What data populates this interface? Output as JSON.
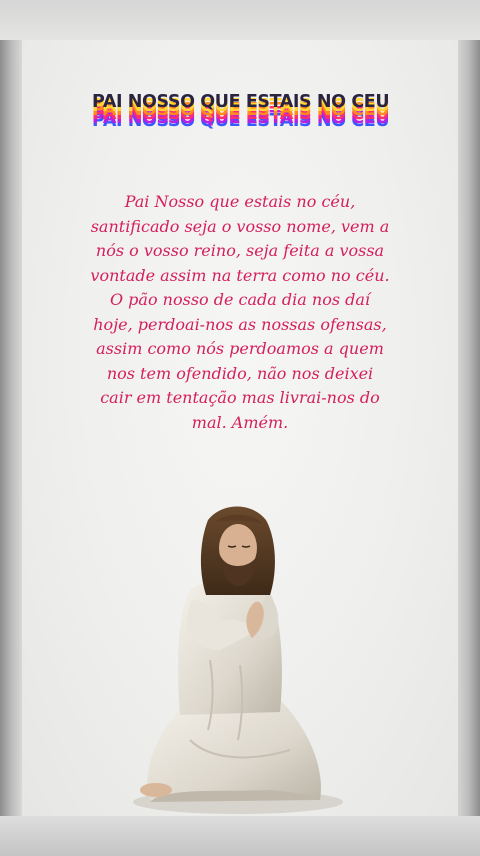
{
  "title": "PAI NOSSO QUE ESTAIS NO CEU",
  "prayer_lines": [
    "Pai Nosso que estais no céu,",
    "santificado seja o vosso nome, vem a",
    "nós o vosso reino, seja feita a vossa",
    "vontade assim na terra como no céu.",
    "O pão nosso de cada dia nos daí",
    "hoje, perdoai-nos as nossas ofensas,",
    "assim como nós perdoamos a quem",
    "nos tem ofendido, não nos deixei",
    "cair em tentação mas livrai-nos do",
    "mal. Amém."
  ],
  "colors": {
    "prayer_text": "#d41f5f",
    "title_top": "#2b2340",
    "title_layers": [
      "#ffd633",
      "#ff8a1e",
      "#ff2d6f",
      "#b81fe0",
      "#3b57ff"
    ]
  },
  "image": {
    "subject": "kneeling-praying-figure-in-white-robe"
  }
}
